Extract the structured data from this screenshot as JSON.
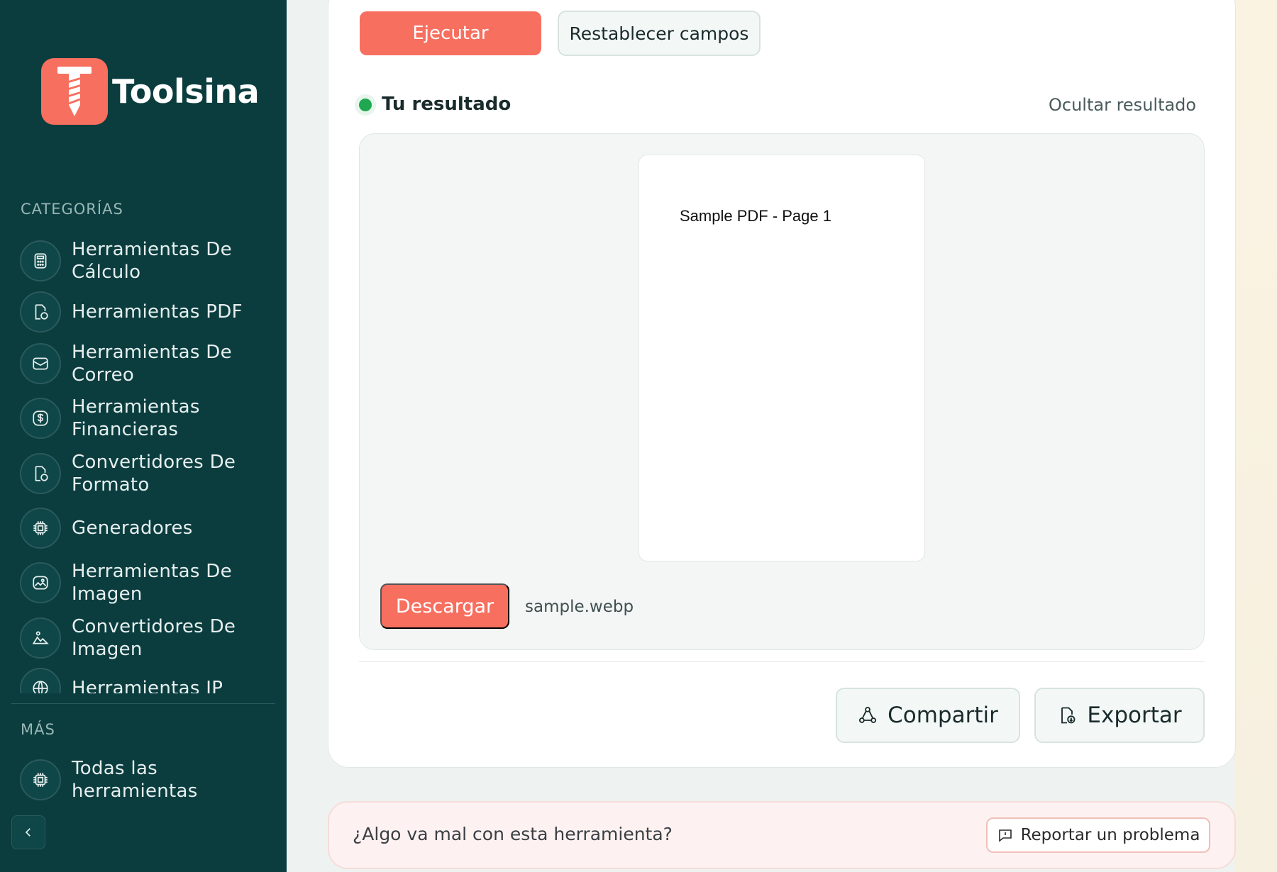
{
  "brand": {
    "name": "Toolsina"
  },
  "sidebar": {
    "categories_heading": "CATEGORÍAS",
    "categories": [
      {
        "label": "Herramientas De Cálculo",
        "icon": "calculator-icon"
      },
      {
        "label": "Herramientas PDF",
        "icon": "document-icon"
      },
      {
        "label": "Herramientas De Correo",
        "icon": "mail-icon"
      },
      {
        "label": "Herramientas Financieras",
        "icon": "dollar-icon"
      },
      {
        "label": "Convertidores De Formato",
        "icon": "document-icon"
      },
      {
        "label": "Generadores",
        "icon": "cpu-icon"
      },
      {
        "label": "Herramientas De Imagen",
        "icon": "image-icon"
      },
      {
        "label": "Convertidores De Imagen",
        "icon": "landscape-icon"
      },
      {
        "label": "Herramientas IP",
        "icon": "globe-icon"
      }
    ],
    "more_heading": "MÁS",
    "more_items": [
      {
        "label": "Todas las herramientas",
        "icon": "cpu-icon"
      }
    ]
  },
  "actions": {
    "run_label": "Ejecutar",
    "reset_label": "Restablecer campos"
  },
  "result": {
    "title": "Tu resultado",
    "hide_label": "Ocultar resultado",
    "preview_text": "Sample PDF - Page 1",
    "download_label": "Descargar",
    "file_name": "sample.webp"
  },
  "footer_actions": {
    "share_label": "Compartir",
    "export_label": "Exportar"
  },
  "report": {
    "question": "¿Algo va mal con esta herramienta?",
    "button_label": "Reportar un problema"
  },
  "colors": {
    "sidebar_bg": "#0b3d3f",
    "accent": "#f76f5f",
    "success": "#1fa84f"
  }
}
